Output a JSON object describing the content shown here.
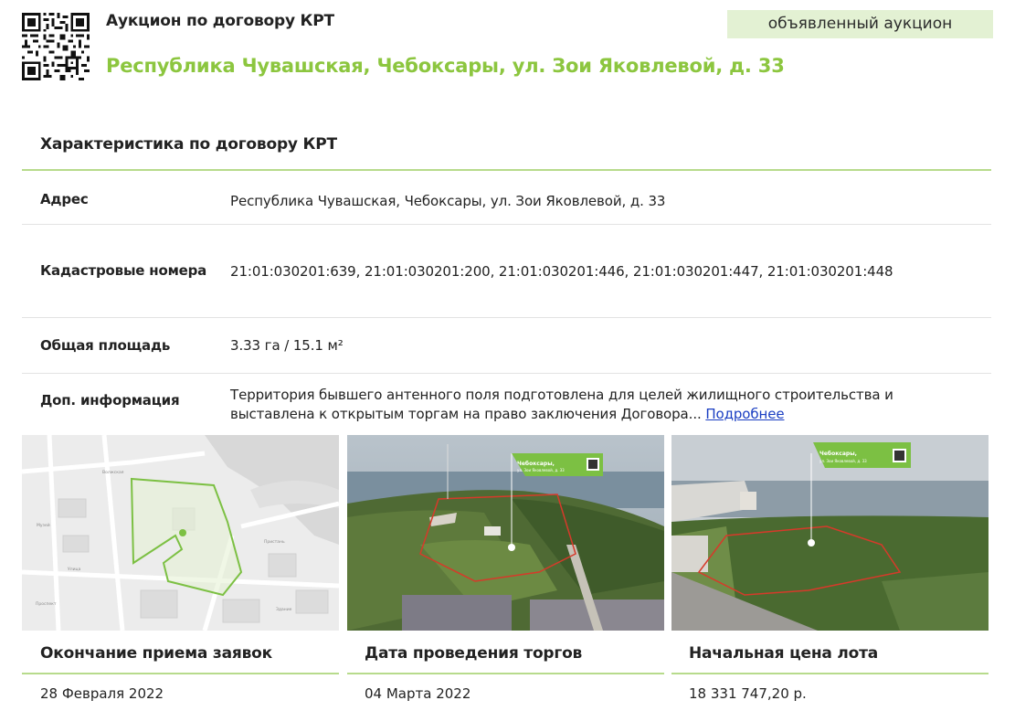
{
  "header": {
    "lot_type": "Аукцион по договору КРТ",
    "address_title": "Республика Чувашская, Чебоксары, ул. Зои Яковлевой, д. 33",
    "status": "объявленный аукцион"
  },
  "characteristics": {
    "title": "Характеристика по договору КРТ",
    "rows": [
      {
        "label": "Адрес",
        "value": "Республика Чувашская, Чебоксары, ул. Зои Яковлевой, д. 33"
      },
      {
        "label": "Кадастровые номера",
        "value": "21:01:030201:639, 21:01:030201:200, 21:01:030201:446, 21:01:030201:447, 21:01:030201:448"
      },
      {
        "label": "Общая площадь",
        "value": "3.33 га / 15.1 м²"
      },
      {
        "label": "Доп. информация",
        "value": "Территория бывшего антенного поля подготовлена для целей жилищного строительства и выставлена к открытым торгам на право заключения Договора...",
        "link_label": "Подробнее"
      }
    ]
  },
  "media": {
    "map_alt": "map-thumbnail",
    "photo_tag_city": "Чебоксары,",
    "photo_tag_street": "ул. Зои Яковлевой, д. 33"
  },
  "info": {
    "deadline_label": "Окончание приема заявок",
    "deadline_value": "28 Февраля 2022",
    "auction_date_label": "Дата проведения торгов",
    "auction_date_value": "04 Марта 2022",
    "start_price_label": "Начальная цена лота",
    "start_price_value": "18 331 747,20 р."
  },
  "colors": {
    "accent_green": "#8cc63f",
    "badge_bg": "#e3f1d3",
    "divider_green": "#b7db8c",
    "link_blue": "#1a3ec2"
  }
}
